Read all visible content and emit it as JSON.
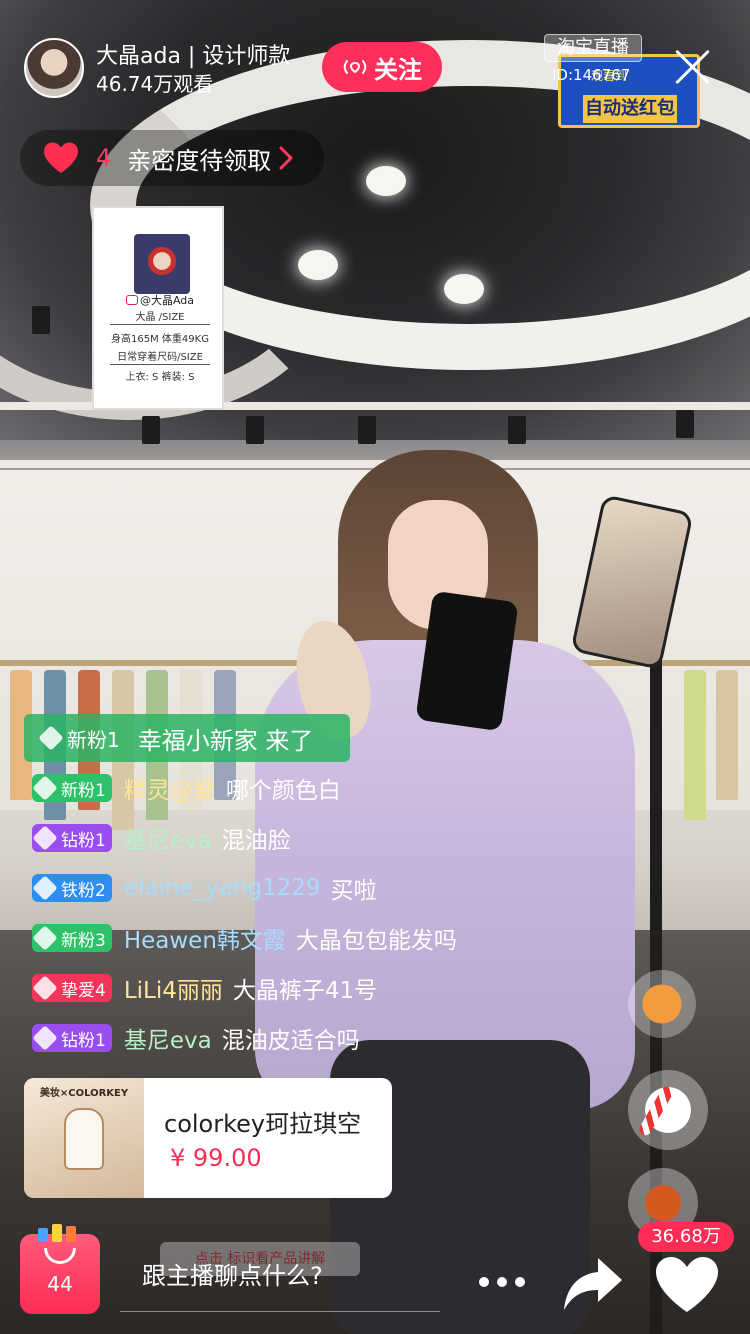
{
  "host": {
    "name": "大晶ada | 设计师款",
    "viewers": "46.74万观看",
    "follow_label": "关注"
  },
  "brand": {
    "tag": "淘宝直播",
    "room_id": "ID:146767"
  },
  "promo": {
    "top_text": "观看到",
    "bottom_text": "自动送红包"
  },
  "intimacy": {
    "count": "4",
    "label": "亲密度待领取"
  },
  "size_card": {
    "handle": "@大晶Ada",
    "name_line": "大晶 /SIZE",
    "stats_line": "身高165M  体重49KG",
    "usual_line": "日常穿着尺码/SIZE",
    "sizes_line": "上衣: S   裤装: S"
  },
  "join_banner": {
    "badge": "新粉1",
    "text": "幸福小新家 来了"
  },
  "comments": [
    {
      "badge": "新粉1",
      "badge_color": "#2fc06a",
      "user": "精灵@爱",
      "text": "哪个颜色白"
    },
    {
      "badge": "钻粉1",
      "badge_color": "#9a4ef2",
      "user": "基尼eva",
      "text": "混油脸"
    },
    {
      "badge": "铁粉2",
      "badge_color": "#2e8ef0",
      "user": "elaine_yang1229",
      "text": "买啦"
    },
    {
      "badge": "新粉3",
      "badge_color": "#2fc06a",
      "user": "Heawen韩文霞",
      "text": "大晶包包能发吗"
    },
    {
      "badge": "挚爱4",
      "badge_color": "#f2345b",
      "user": "LiLi4丽丽",
      "text": "大晶裤子41号"
    },
    {
      "badge": "钻粉1",
      "badge_color": "#9a4ef2",
      "user": "基尼eva",
      "text": "混油皮适合吗"
    }
  ],
  "product": {
    "thumb_brand": "美妆×COLORKEY",
    "title": "colorkey珂拉琪空",
    "price": "¥ 99.00"
  },
  "bottom": {
    "bag_count": "44",
    "chat_placeholder": "跟主播聊点什么?",
    "like_count": "36.68万",
    "explain_tag": "点击 标识看产品讲解"
  },
  "icons": {
    "close": "close-icon",
    "heart": "heart-icon",
    "share": "share-icon",
    "more": "more-icon",
    "live": "live-signal-icon"
  }
}
